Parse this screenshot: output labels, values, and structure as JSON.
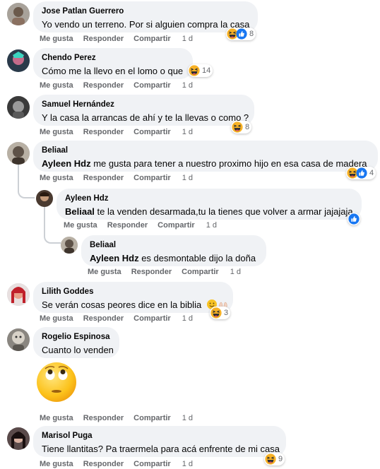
{
  "actions": {
    "like": "Me gusta",
    "reply": "Responder",
    "share": "Compartir",
    "time": "1 d"
  },
  "comments": [
    {
      "author": "Jose Patlan Guerrero",
      "text": "Yo vendo un terreno. Por si alguien compra la casa",
      "reactions": "8"
    },
    {
      "author": "Chendo Perez",
      "text": "Cómo me la llevo en el lomo o que",
      "reactions": "14"
    },
    {
      "author": "Samuel Hernández",
      "text": "Y la casa la arrancas de ahí y te la llevas o como ?",
      "reactions": "8"
    },
    {
      "author": "Beliaal",
      "mention": "Ayleen Hdz",
      "text": " me gusta para tener a nuestro proximo hijo en esa casa de madera",
      "reactions": "4"
    },
    {
      "author": "Ayleen Hdz",
      "mention": "Beliaal",
      "text": " te la venden desarmada,tu la tienes que volver a armar jajajaja"
    },
    {
      "author": "Beliaal",
      "mention": "Ayleen Hdz",
      "text": " es desmontable dijo la doña"
    },
    {
      "author": "Lilith Goddes",
      "text": "Se verán cosas peores dice en la biblia",
      "reactions": "3"
    },
    {
      "author": "Rogelio Espinosa",
      "text": "Cuanto lo venden"
    },
    {
      "author": "Marisol Puga",
      "text": "Tiene llantitas? Pa traermela para acá enfrente de mi casa",
      "reactions": "9"
    }
  ],
  "colors": {
    "bubble": "#f0f2f5",
    "meta": "#65676b",
    "like_blue": "#1877f2",
    "haha_yellow": "#f7b125"
  }
}
